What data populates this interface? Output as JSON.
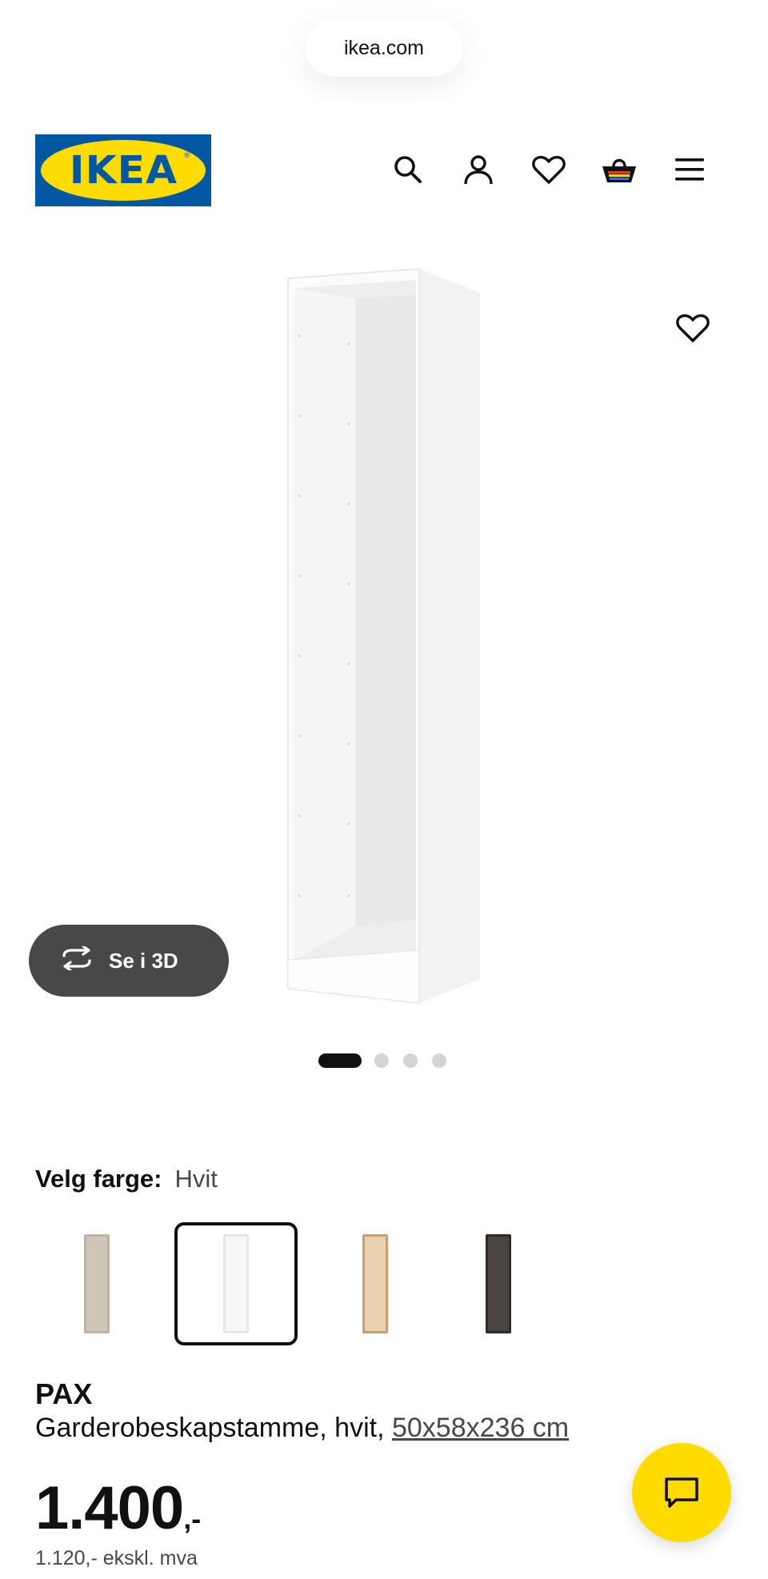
{
  "browser": {
    "url": "ikea.com"
  },
  "header": {
    "logo_text": "IKEA",
    "icons": [
      "search-icon",
      "account-icon",
      "heart-icon",
      "cart-icon",
      "menu-icon"
    ]
  },
  "gallery": {
    "view_3d_label": "Se i 3D",
    "page_count": 4,
    "active_page": 1
  },
  "color_picker": {
    "label": "Velg farge:",
    "selected": "Hvit",
    "swatches": [
      {
        "color": "#cfc6b8"
      },
      {
        "color": "#f4f4f4",
        "selected": true
      },
      {
        "color": "#d9b48c"
      },
      {
        "color": "#3a3631"
      }
    ]
  },
  "product": {
    "name": "PAX",
    "description": "Garderobeskapstamme, hvit,",
    "dimensions": "50x58x236 cm",
    "price_int": "1.400",
    "price_suffix": ",-",
    "price_ex_vat": "1.120,- ekskl. mva"
  },
  "colors": {
    "brand_blue": "#0058a3",
    "brand_yellow": "#ffdb00",
    "dark_button": "#484848"
  }
}
